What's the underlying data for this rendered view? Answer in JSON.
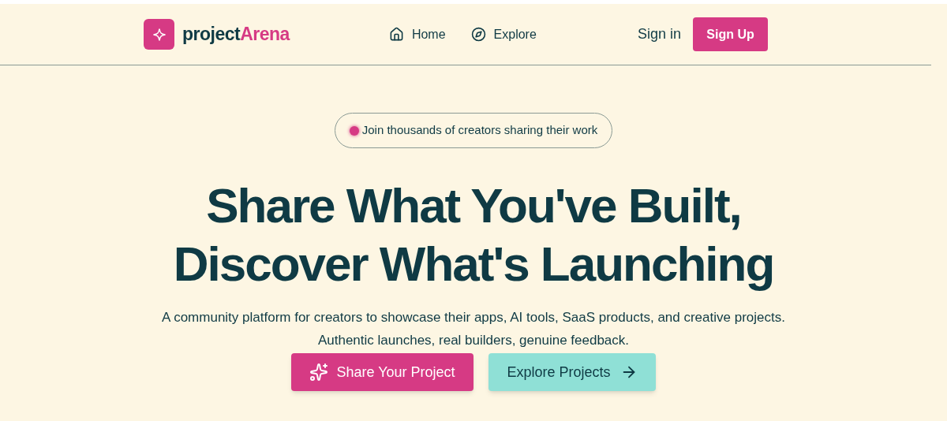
{
  "nav": {
    "logo": {
      "first": "project",
      "second": "Arena"
    },
    "links": [
      {
        "label": "Home",
        "kind": "home",
        "selected": false
      },
      {
        "label": "Explore",
        "kind": "compass",
        "selected": false
      }
    ],
    "sign_in": "Sign in",
    "sign_up": "Sign Up"
  },
  "hero": {
    "badge": "Join thousands of creators sharing their work",
    "title_lines": [
      "Share What You've Built,",
      "Discover What's Launching"
    ],
    "subtitle": "A community platform for creators to showcase their apps, AI tools, SaaS products, and creative projects. Authentic launches, real builders, genuine feedback.",
    "primary_button": "Share Your Project",
    "secondary_button": "Explore Projects"
  }
}
